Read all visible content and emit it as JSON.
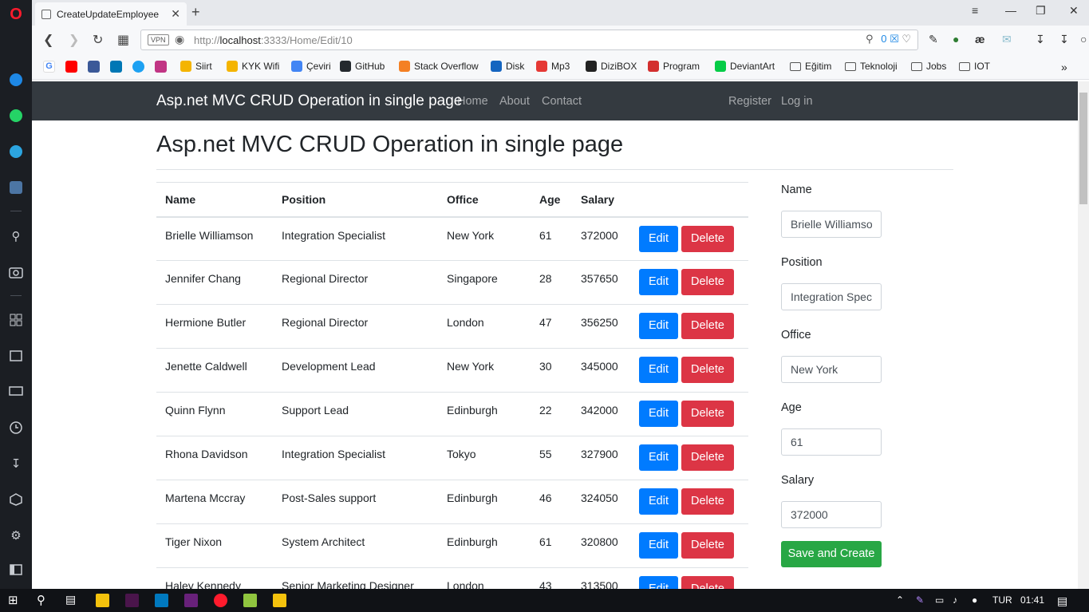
{
  "browser": {
    "tab_title": "CreateUpdateEmployee",
    "url_host": "localhost",
    "url_prefix": "http://",
    "url_path": ":3333/Home/Edit/10",
    "vpn_label": "VPN",
    "badge_count": "0"
  },
  "bookmarks": [
    {
      "label": "Siirt",
      "color": "#f4b400"
    },
    {
      "label": "KYK Wifi",
      "color": "#f4b400"
    },
    {
      "label": "Çeviri",
      "color": "#4285f4"
    },
    {
      "label": "GitHub",
      "color": "#24292e"
    },
    {
      "label": "Stack Overflow",
      "color": "#f48024"
    },
    {
      "label": "Disk",
      "color": "#1565c0"
    },
    {
      "label": "Mp3",
      "color": "#e53935"
    },
    {
      "label": "DiziBOX",
      "color": "#222222"
    },
    {
      "label": "Program",
      "color": "#d32f2f"
    },
    {
      "label": "DeviantArt",
      "color": "#05cc47"
    },
    {
      "label": "Eğitim",
      "color": "folder"
    },
    {
      "label": "Teknoloji",
      "color": "folder"
    },
    {
      "label": "Jobs",
      "color": "folder"
    },
    {
      "label": "IOT",
      "color": "folder"
    }
  ],
  "site": {
    "brand": "Asp.net MVC CRUD Operation in single page",
    "nav": [
      "Home",
      "About",
      "Contact"
    ],
    "nav_right": [
      "Register",
      "Log in"
    ],
    "page_title": "Asp.net MVC CRUD Operation in single page"
  },
  "table": {
    "headers": [
      "Name",
      "Position",
      "Office",
      "Age",
      "Salary"
    ],
    "edit_label": "Edit",
    "delete_label": "Delete",
    "rows": [
      [
        "Brielle Williamson",
        "Integration Specialist",
        "New York",
        "61",
        "372000"
      ],
      [
        "Jennifer Chang",
        "Regional Director",
        "Singapore",
        "28",
        "357650"
      ],
      [
        "Hermione Butler",
        "Regional Director",
        "London",
        "47",
        "356250"
      ],
      [
        "Jenette Caldwell",
        "Development Lead",
        "New York",
        "30",
        "345000"
      ],
      [
        "Quinn Flynn",
        "Support Lead",
        "Edinburgh",
        "22",
        "342000"
      ],
      [
        "Rhona Davidson",
        "Integration Specialist",
        "Tokyo",
        "55",
        "327900"
      ],
      [
        "Martena Mccray",
        "Post-Sales support",
        "Edinburgh",
        "46",
        "324050"
      ],
      [
        "Tiger Nixon",
        "System Architect",
        "Edinburgh",
        "61",
        "320800"
      ],
      [
        "Haley Kennedy",
        "Senior Marketing Designer",
        "London",
        "43",
        "313500"
      ]
    ]
  },
  "form": {
    "fields": [
      {
        "label": "Name",
        "value": "Brielle Williamson"
      },
      {
        "label": "Position",
        "value": "Integration Specialist"
      },
      {
        "label": "Office",
        "value": "New York"
      },
      {
        "label": "Age",
        "value": "61"
      },
      {
        "label": "Salary",
        "value": "372000"
      }
    ],
    "submit_label": "Save and Create"
  },
  "taskbar": {
    "language": "TUR",
    "time": "01:41"
  },
  "colors": {
    "primary": "#007bff",
    "danger": "#dc3545",
    "success": "#28a745",
    "navbar": "#343a40"
  }
}
